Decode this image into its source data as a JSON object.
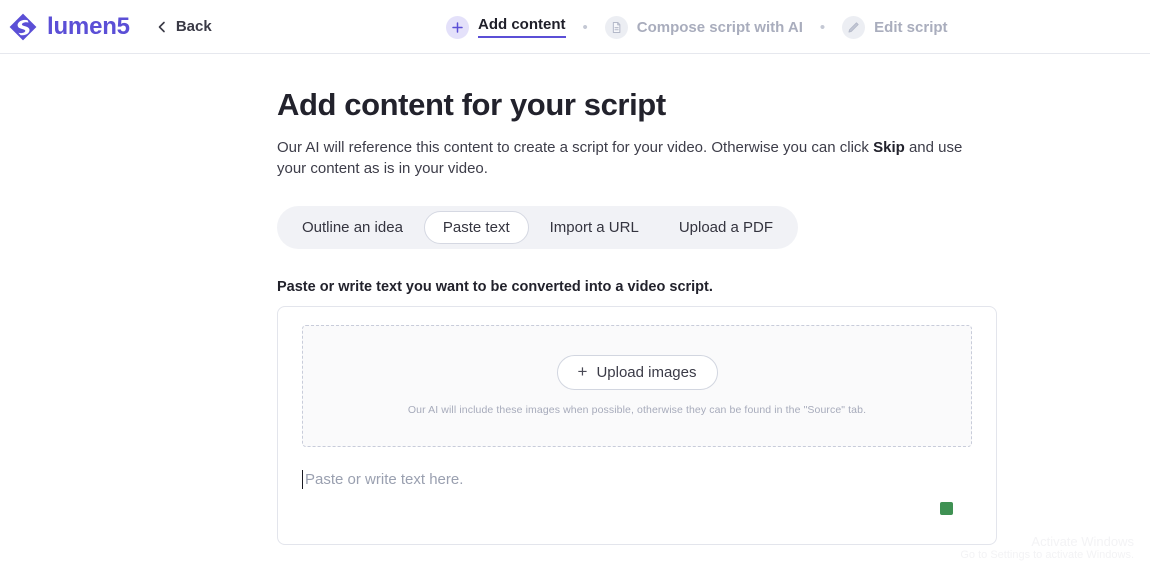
{
  "header": {
    "brand_name": "lumen5",
    "logo_icon": "lumen5-diamond-logo",
    "back": {
      "label": "Back",
      "icon": "chevron-left-icon"
    },
    "steps": [
      {
        "label": "Add content",
        "icon": "plus-circle-icon",
        "state": "active"
      },
      {
        "label": "Compose script with AI",
        "icon": "document-icon",
        "state": "inactive"
      },
      {
        "label": "Edit script",
        "icon": "pencil-icon",
        "state": "inactive"
      }
    ],
    "separator": "•"
  },
  "main": {
    "title": "Add content for your script",
    "description_part1": "Our AI will reference this content to create a script for your video. Otherwise you can click ",
    "description_bold": "Skip",
    "description_part2": " and use your content as is in your video.",
    "tabs": [
      {
        "label": "Outline an idea",
        "selected": false
      },
      {
        "label": "Paste text",
        "selected": true
      },
      {
        "label": "Import a URL",
        "selected": false
      },
      {
        "label": "Upload a PDF",
        "selected": false
      }
    ],
    "field_label": "Paste or write text you want to be converted into a video script.",
    "dropzone": {
      "upload_button_label": "Upload images",
      "upload_button_icon": "plus-icon",
      "hint": "Our AI will include these images when possible, otherwise they can be found in the \"Source\" tab."
    },
    "textarea": {
      "value": "",
      "placeholder": "Paste or write text here."
    },
    "grammar_indicator": {
      "name": "grammar-check-indicator",
      "color": "#3f9153"
    }
  },
  "watermark": {
    "line1": "Activate Windows",
    "line2": "Go to Settings to activate Windows."
  },
  "colors": {
    "brand_purple": "#5b4fd6",
    "accent_underline": "#5b4fd6",
    "tab_track": "#f1f2f6",
    "border": "#e3e5ec",
    "muted_text": "#a9adbd",
    "green_status": "#3f9153"
  }
}
